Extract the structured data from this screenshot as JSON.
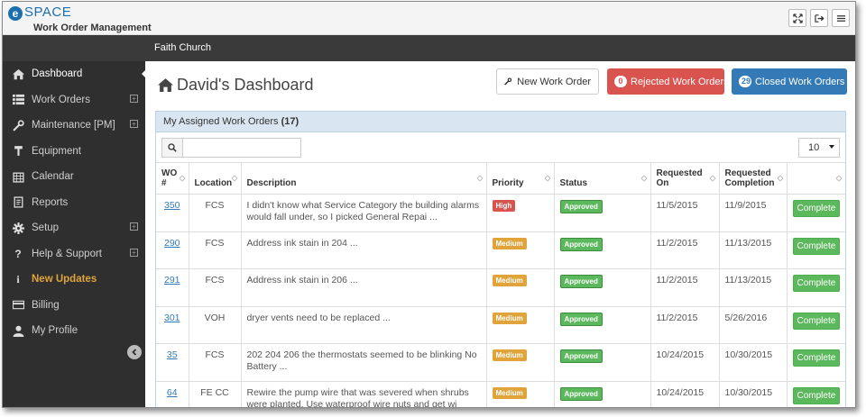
{
  "app": {
    "logo_text": "SPACE",
    "logo_mark": "e",
    "subtitle": "Work Order Management"
  },
  "top_actions": [
    {
      "name": "fullscreen-icon"
    },
    {
      "name": "logout-icon"
    },
    {
      "name": "menu-icon"
    }
  ],
  "sidebar": {
    "items": [
      {
        "label": "Dashboard",
        "icon": "home-icon",
        "expandable": false,
        "active": true
      },
      {
        "label": "Work Orders",
        "icon": "list-icon",
        "expandable": true
      },
      {
        "label": "Maintenance [PM]",
        "icon": "wrench-icon",
        "expandable": true
      },
      {
        "label": "Equipment",
        "icon": "equipment-icon",
        "expandable": false
      },
      {
        "label": "Calendar",
        "icon": "calendar-icon",
        "expandable": false
      },
      {
        "label": "Reports",
        "icon": "reports-icon",
        "expandable": false
      },
      {
        "label": "Setup",
        "icon": "gear-icon",
        "expandable": true
      },
      {
        "label": "Help & Support",
        "icon": "question-icon",
        "expandable": true
      },
      {
        "label": "New Updates",
        "icon": "info-icon",
        "expandable": false,
        "highlight": true
      },
      {
        "label": "Billing",
        "icon": "credit-card-icon",
        "expandable": false
      },
      {
        "label": "My Profile",
        "icon": "user-icon",
        "expandable": false
      }
    ]
  },
  "org_name": "Faith Church",
  "page_title": "David's Dashboard",
  "buttons": {
    "new_work_order": "New Work Order",
    "rejected_count": "0",
    "rejected_label": "Rejected Work Orders",
    "closed_count": "29",
    "closed_label": "Closed Work Orders"
  },
  "panel": {
    "title": "My Assigned Work Orders",
    "count": "(17)",
    "search_value": "",
    "page_size": "10"
  },
  "table": {
    "columns": [
      "WO #",
      "Location",
      "Description",
      "Priority",
      "Status",
      "Requested On",
      "Requested Completion",
      ""
    ],
    "rows": [
      {
        "wo": "350",
        "location": "FCS",
        "description": "I didn't know what Service Category the building alarms would fall under, so I picked General Repai ...",
        "priority": "High",
        "status": "Approved",
        "requested_on": "11/5/2015",
        "requested_completion": "11/9/2015",
        "action": "Complete"
      },
      {
        "wo": "290",
        "location": "FCS",
        "description": "Address ink stain in 204 ...",
        "priority": "Medium",
        "status": "Approved",
        "requested_on": "11/2/2015",
        "requested_completion": "11/13/2015",
        "action": "Complete"
      },
      {
        "wo": "291",
        "location": "FCS",
        "description": "Address ink stain in 206 ...",
        "priority": "Medium",
        "status": "Approved",
        "requested_on": "11/2/2015",
        "requested_completion": "11/13/2015",
        "action": "Complete"
      },
      {
        "wo": "301",
        "location": "VOH",
        "description": "dryer vents need to be replaced ...",
        "priority": "Medium",
        "status": "Approved",
        "requested_on": "11/2/2015",
        "requested_completion": "5/26/2016",
        "action": "Complete"
      },
      {
        "wo": "35",
        "location": "FCS",
        "description": "202 204 206 the thermostats seemed to be blinking No Battery ...",
        "priority": "Medium",
        "status": "Approved",
        "requested_on": "10/24/2015",
        "requested_completion": "10/30/2015",
        "action": "Complete"
      },
      {
        "wo": "64",
        "location": "FE CC",
        "description": "Rewire the pump wire that was severed when shrubs were planted. Use waterproof wire nuts and get wi",
        "priority": "Medium",
        "status": "Approved",
        "requested_on": "10/24/2015",
        "requested_completion": "10/30/2015",
        "action": "Complete"
      }
    ]
  },
  "colors": {
    "brand": "#1b6fae",
    "sidebar": "#2f2f2f",
    "danger": "#d9534f",
    "primary": "#337ab7",
    "warning": "#e0a43a",
    "success": "#5cb85c"
  }
}
